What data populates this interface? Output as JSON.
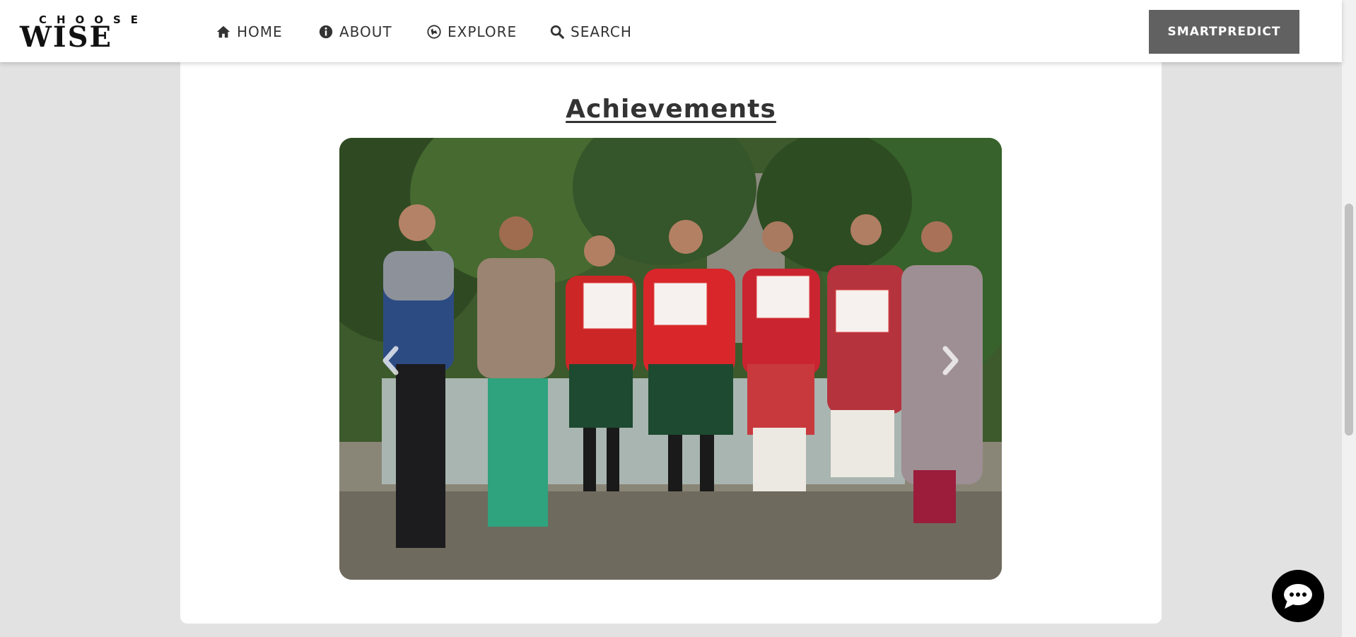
{
  "brand": {
    "line1": "CHOOSE",
    "line2": "WISE"
  },
  "nav": {
    "items": [
      {
        "label": "HOME",
        "icon": "home-icon"
      },
      {
        "label": "ABOUT",
        "icon": "info-icon"
      },
      {
        "label": "EXPLORE",
        "icon": "compass-icon"
      },
      {
        "label": "SEARCH",
        "icon": "search-icon"
      }
    ],
    "cta_label": "SMARTPREDICT"
  },
  "section": {
    "title": "Achievements"
  },
  "carousel": {
    "prev_icon": "chevron-left-icon",
    "next_icon": "chevron-right-icon"
  },
  "chat": {
    "icon": "chat-bubble-icon"
  },
  "colors": {
    "cta_bg": "#616161",
    "page_bg": "#e2e2e2",
    "card_bg": "#ffffff",
    "text": "#333333"
  }
}
